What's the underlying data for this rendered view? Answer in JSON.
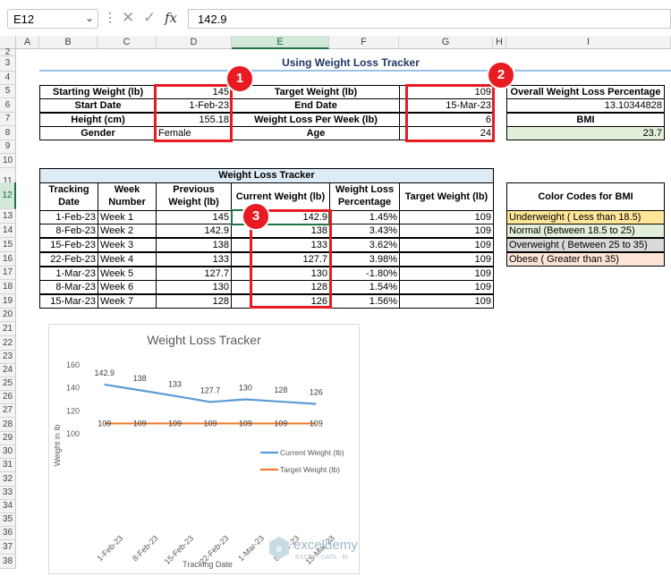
{
  "formula_bar": {
    "name_box": "E12",
    "menu_icon": "vertical-ellipsis-icon",
    "cancel_icon": "x-icon",
    "enter_icon": "check-icon",
    "function_icon": "fx",
    "value": "142.9"
  },
  "columns": [
    "A",
    "B",
    "C",
    "D",
    "E",
    "F",
    "G",
    "H",
    "I"
  ],
  "rows": [
    "2",
    "3",
    "4",
    "5",
    "6",
    "7",
    "8",
    "9",
    "10",
    "11",
    "12",
    "13",
    "14",
    "15",
    "16",
    "17",
    "18",
    "19",
    "20",
    "21",
    "22",
    "23",
    "24",
    "25",
    "26",
    "27",
    "28",
    "29",
    "30",
    "31",
    "32",
    "33",
    "34",
    "35",
    "36",
    "37",
    "38"
  ],
  "selected_cell": {
    "col": "E",
    "row": "12"
  },
  "sheet": {
    "title": "Using Weight Loss Tracker",
    "inputs": {
      "starting_weight_label": "Starting Weight (lb)",
      "starting_weight": "145",
      "start_date_label": "Start Date",
      "start_date": "1-Feb-23",
      "height_label": "Height (cm)",
      "height": "155.18",
      "gender_label": "Gender",
      "gender": "Female",
      "target_weight_label": "Target Weight (lb)",
      "target_weight": "109",
      "end_date_label": "End Date",
      "end_date": "15-Mar-23",
      "weight_loss_per_week_label": "Weight Loss Per Week (lb)",
      "weight_loss_per_week": "6",
      "age_label": "Age",
      "age": "24"
    },
    "overall": {
      "label": "Overall Weight Loss Percentage",
      "value": "13.10344828",
      "bmi_label": "BMI",
      "bmi_value": "23.7",
      "bmi_color": "#e2efda"
    },
    "tracker": {
      "title": "Weight Loss Tracker",
      "title_color": "#ddebf7",
      "headers": {
        "date": "Tracking Date",
        "week": "Week Number",
        "previous": "Previous Weight (lb)",
        "current": "Current Weight (lb)",
        "percentage": "Weight Loss Percentage",
        "target": "Target Weight (lb)"
      },
      "rows": [
        {
          "date": "1-Feb-23",
          "week": "Week 1",
          "previous": "145",
          "current": "142.9",
          "percentage": "1.45%",
          "target": "109"
        },
        {
          "date": "8-Feb-23",
          "week": "Week 2",
          "previous": "142.9",
          "current": "138",
          "percentage": "3.43%",
          "target": "109"
        },
        {
          "date": "15-Feb-23",
          "week": "Week 3",
          "previous": "138",
          "current": "133",
          "percentage": "3.62%",
          "target": "109"
        },
        {
          "date": "22-Feb-23",
          "week": "Week 4",
          "previous": "133",
          "current": "127.7",
          "percentage": "3.98%",
          "target": "109"
        },
        {
          "date": "1-Mar-23",
          "week": "Week 5",
          "previous": "127.7",
          "current": "130",
          "percentage": "-1.80%",
          "target": "109"
        },
        {
          "date": "8-Mar-23",
          "week": "Week 6",
          "previous": "130",
          "current": "128",
          "percentage": "1.54%",
          "target": "109"
        },
        {
          "date": "15-Mar-23",
          "week": "Week 7",
          "previous": "128",
          "current": "126",
          "percentage": "1.56%",
          "target": "109"
        }
      ]
    },
    "color_codes": {
      "title": "Color Codes for BMI",
      "items": [
        {
          "label": "Underweight ( Less than 18.5)",
          "color": "#ffe699"
        },
        {
          "label": "Normal (Between 18.5 to 25)",
          "color": "#e2efda"
        },
        {
          "label": "Overweight ( Between 25 to 35)",
          "color": "#d9d9d9"
        },
        {
          "label": "Obese ( Greater than 35)",
          "color": "#fce4d6"
        }
      ]
    },
    "badges": [
      "1",
      "2",
      "3"
    ],
    "accent_red": "#e81a22"
  },
  "chart_data": {
    "type": "line",
    "title": "Weight Loss Tracker",
    "xlabel": "Tracking Date",
    "ylabel": "Weight in lb",
    "categories": [
      "1-Feb-23",
      "8-Feb-23",
      "15-Feb-23",
      "22-Feb-23",
      "1-Mar-23",
      "8-Mar-23",
      "15-Mar-23"
    ],
    "series": [
      {
        "name": "Current Weight (lb)",
        "values": [
          142.9,
          138,
          133,
          127.7,
          130,
          128,
          126
        ],
        "labels": [
          "142.9",
          "138",
          "133",
          "127.7",
          "130",
          "128",
          "126"
        ],
        "color": "#5b9bd5"
      },
      {
        "name": "Target Weight (lb)",
        "values": [
          109,
          109,
          109,
          109,
          109,
          109,
          109
        ],
        "labels": [
          "109",
          "109",
          "109",
          "109",
          "109",
          "109",
          "109"
        ],
        "color": "#ed7d31"
      }
    ],
    "yticks": [
      "160",
      "140",
      "120",
      "100"
    ],
    "ylim": [
      100,
      160
    ],
    "legend_position": "right",
    "grid": false
  },
  "watermark": {
    "brand": "exceldemy",
    "tagline": "EXCEL · DATA · BI"
  }
}
